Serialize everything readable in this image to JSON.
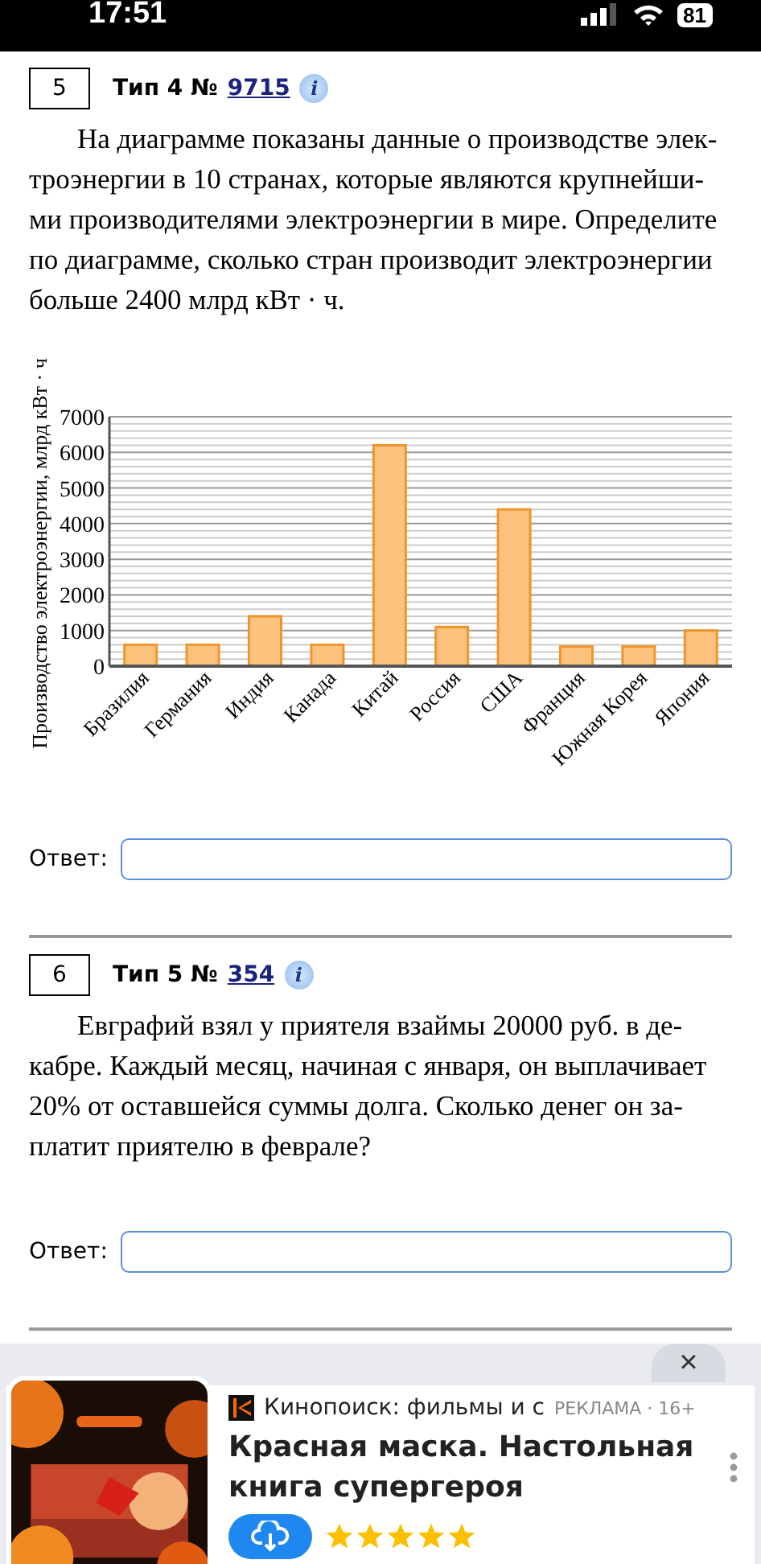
{
  "status_bar": {
    "time": "17:51",
    "battery": "81"
  },
  "problems": [
    {
      "number": "5",
      "type": "Тип 4 №",
      "id": "9715",
      "info": "i",
      "text": "На диаграмме показаны данные о производстве элек-\nтроэнергии в 10 странах, которые являются крупнейши-\nми производителями электроэнергии в мире. Определите\nпо диаграмме, сколько стран производит электроэнергии\nбольше 2400 млрд кВт · ч.",
      "answer_label": "Ответ:",
      "chart_data": {
        "type": "bar",
        "ylabel": "Производство электроэнергии, млрд кВт · ч",
        "categories": [
          "Бразилия",
          "Германия",
          "Индия",
          "Канада",
          "Китай",
          "Россия",
          "США",
          "Франция",
          "Южная Корея",
          "Япония"
        ],
        "grid": true,
        "series": [
          {
            "color": "#fcc27e",
            "values": [
              600,
              600,
              1400,
              600,
              6200,
              1100,
              4400,
              550,
              550,
              1000
            ]
          }
        ],
        "ylim": [
          0,
          7000
        ],
        "yticks": [
          0,
          1000,
          2000,
          3000,
          4000,
          5000,
          6000,
          7000
        ]
      }
    },
    {
      "number": "6",
      "type": "Тип 5 №",
      "id": "354",
      "info": "i",
      "text": "Евграфий взял у приятеля взаймы 20000 руб. в де-\nкабре. Каждый месяц, начиная с января, он выплачивает\n20% от оставшейся суммы долга. Сколько денег он за-\nплатит приятелю в феврале?",
      "answer_label": "Ответ:"
    }
  ],
  "ad": {
    "close": "×",
    "source": "Кинопоиск: фильмы и с",
    "label": "РЕКЛАМА · 16+",
    "title": "Красная маска. Настольная книга супергероя",
    "stars": 5
  }
}
